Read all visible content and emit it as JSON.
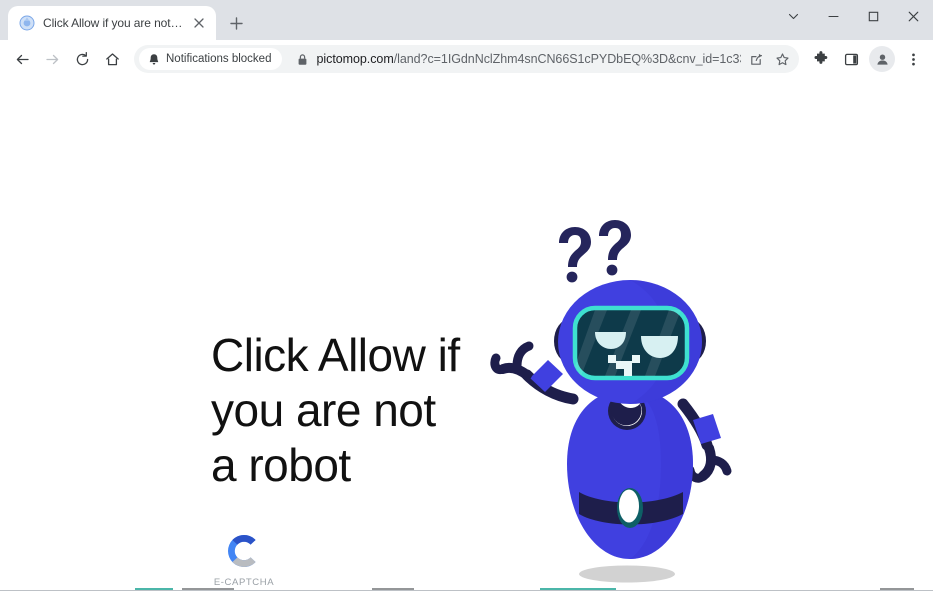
{
  "window": {
    "controls": [
      {
        "name": "tab-search",
        "icon": "chevron-down-icon"
      },
      {
        "name": "minimize",
        "icon": "minimize-icon"
      },
      {
        "name": "maximize",
        "icon": "maximize-icon"
      },
      {
        "name": "close",
        "icon": "close-icon"
      }
    ]
  },
  "tab": {
    "title": "Click Allow if you are not a robot",
    "favicon": "blue-circle-favicon",
    "close_icon": "close-icon",
    "newtab_icon": "plus-icon"
  },
  "toolbar": {
    "back_icon": "back-arrow-icon",
    "forward_icon": "forward-arrow-icon",
    "reload_icon": "reload-icon",
    "home_icon": "home-icon",
    "notifications_chip": {
      "label": "Notifications blocked",
      "icon": "bell-icon"
    },
    "lock_icon": "lock-icon",
    "url_host": "pictomop.com",
    "url_path": "/land?c=1IGdnNclZhm4snCN66S1cPYDbEQ%3D&cnv_id=1c337f4130fb5e…",
    "share_icon": "share-icon",
    "bookmark_icon": "star-icon",
    "extensions_icon": "puzzle-icon",
    "sidepanel_icon": "side-panel-icon",
    "profile_icon": "avatar-icon",
    "menu_icon": "three-dot-menu-icon"
  },
  "page": {
    "headline": "Click Allow if you are not a robot",
    "captcha": {
      "mark": "letter-c-logo",
      "label": "E-CAPTCHA"
    },
    "robot": {
      "alt": "confused-robot-illustration",
      "question_marks": "??"
    }
  },
  "colors": {
    "robot_body": "#4040e0",
    "robot_dark": "#1e1e4b",
    "visor_border": "#3ee0d0",
    "visor_fill": "#0e3a4a",
    "captcha_blue": "#2b62d4",
    "captcha_gray": "#b9bcc0",
    "shadow": "#d2d2d2"
  }
}
